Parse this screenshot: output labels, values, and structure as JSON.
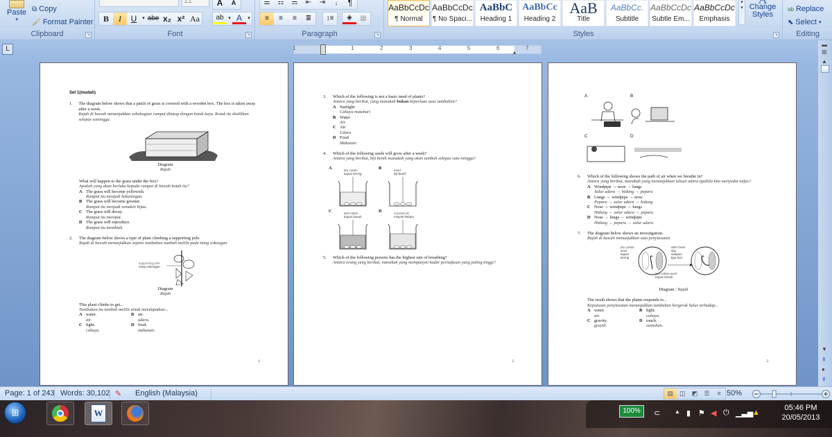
{
  "ribbon": {
    "clipboard": {
      "label": "Clipboard",
      "paste": "Paste",
      "copy": "Copy",
      "format_painter": "Format Painter"
    },
    "font": {
      "label": "Font",
      "size": "12",
      "buttons": [
        "B",
        "I",
        "U",
        "abe",
        "x₂",
        "x²",
        "Aa"
      ],
      "grow": "A",
      "shrink": "A",
      "highlight_color": "#ffff00",
      "font_color": "#e8101a"
    },
    "paragraph": {
      "label": "Paragraph"
    },
    "styles": {
      "label": "Styles",
      "items": [
        {
          "preview": "AaBbCcDc",
          "name": "¶ Normal",
          "selected": true
        },
        {
          "preview": "AaBbCcDc",
          "name": "¶ No Spaci..."
        },
        {
          "preview": "AaBbC",
          "name": "Heading 1"
        },
        {
          "preview": "AaBbCc",
          "name": "Heading 2"
        },
        {
          "preview": "AaB",
          "name": "Title"
        },
        {
          "preview": "AaBbCc.",
          "name": "Subtitle"
        },
        {
          "preview": "AaBbCcDc",
          "name": "Subtle Em..."
        },
        {
          "preview": "AaBbCcDc",
          "name": "Emphasis"
        }
      ],
      "change_styles": "Change Styles"
    },
    "editing": {
      "label": "Editing",
      "replace": "Replace",
      "select": "Select"
    }
  },
  "ruler": {
    "tab_selector": "L",
    "numbers": [
      "1",
      "1",
      "2",
      "3",
      "4",
      "5",
      "6",
      "7"
    ]
  },
  "pages": {
    "p1": {
      "set_title": "Set 1(mudah)",
      "q1": {
        "num": "1.",
        "en": "The diagram below shows that a patch of grass is covered with a wooden box. The box is taken away after a week.",
        "ms": "Rajah di bawah menunjukkan sebahagian rumput ditutup dengan kotak kayu. Kotak itu dialihkan selepas seminggu.",
        "caption_en": "Diagram",
        "caption_ms": "Rajah",
        "stem_en": "What will happen to the grass under the box?",
        "stem_ms": "Apakah yang akan berlaku kepada rumput di bawah kotak itu?",
        "options": [
          {
            "letter": "A",
            "en": "The grass will become yellowish.",
            "ms": "Rumput itu menjadi kekuningan."
          },
          {
            "letter": "B",
            "en": "The grass will become greener.",
            "ms": "Rumput itu menjadi semakin hijau."
          },
          {
            "letter": "C",
            "en": "The grass will decay.",
            "ms": "Rumput itu mereput."
          },
          {
            "letter": "D",
            "en": "The grass will reproduce.",
            "ms": "Rumput itu membiak."
          }
        ]
      },
      "q2": {
        "num": "2.",
        "en": "The diagram below shows a type of plant climbing a supporting pole.",
        "ms": "Rajah di bawah menunjukkan sejenis tumbuhan tumbuh melilit pada tiang sokongan.",
        "label_en": "supporting pole",
        "label_ms": "tiang sokongan",
        "caption_en": "Diagram",
        "caption_ms": "Rajah",
        "stem_en": "This plant climbs to get...",
        "stem_ms": "Tumbuhan itu tumbuh melilit untuk mendapatkan...",
        "options": [
          {
            "letter": "A",
            "en": "water.",
            "ms": "air."
          },
          {
            "letter": "B",
            "en": "air.",
            "ms": "udara."
          },
          {
            "letter": "C",
            "en": "light.",
            "ms": "cahaya."
          },
          {
            "letter": "D",
            "en": "food.",
            "ms": "makanan."
          }
        ]
      },
      "page_number": "1"
    },
    "p2": {
      "q3": {
        "num": "3.",
        "en": "Which of the following is not a basic need of plants?",
        "ms_pre": "Antara yang berikut, yang manakah",
        "ms_bold": "bukan",
        "ms_post": "keperluan asas tumbuhan?",
        "options": [
          {
            "letter": "A",
            "en": "Sunlight",
            "ms": "Cahaya matahari"
          },
          {
            "letter": "B",
            "en": "Water",
            "ms": "Air"
          },
          {
            "letter": "C",
            "en": "Air",
            "ms": "Udara"
          },
          {
            "letter": "D",
            "en": "Food",
            "ms": "Makanan"
          }
        ]
      },
      "q4": {
        "num": "4.",
        "en": "Which of the following seeds will grow after a week?",
        "ms": "Antara yang berikut, biji benih manakah yang akan tumbuh selepas satu minggu?",
        "beakers": [
          {
            "letter": "A",
            "en": "dry cotton",
            "ms": "kapas kering"
          },
          {
            "letter": "B",
            "en": "seed",
            "ms": "biji benih"
          },
          {
            "letter": "C",
            "en": "wet cotton",
            "ms": "kapas basah"
          },
          {
            "letter": "D",
            "en": "coconut oil",
            "ms": "minyak kelapa"
          }
        ]
      },
      "q5": {
        "num": "5.",
        "en": "Which of the following persons has the highest rate of breathing?",
        "ms": "Antara orang yang berikut, manakah yang mempunyai kadar pernafasan yang paling tinggi?"
      },
      "page_number": "2"
    },
    "p3": {
      "q5_images": [
        "A",
        "B",
        "C",
        "D"
      ],
      "q6": {
        "num": "6.",
        "en": "Which of the following shows the path of air when we breathe in?",
        "ms": "Antara yang berikut, manakah yang menunjukkan laluan udara apabila kita menyedut nafas?",
        "options": [
          {
            "letter": "A",
            "en": "Windpipe → nose → lungs",
            "ms": "Salur udara → hidung → peparu"
          },
          {
            "letter": "B",
            "en": "Lungs → windpipe → nose",
            "ms": "Peparu → salur udara → hidung"
          },
          {
            "letter": "C",
            "en": "Nose → windpipe → lungs",
            "ms": "Hidung → salur udara → peparu"
          },
          {
            "letter": "D",
            "en": "Nose → lungs → windpipe",
            "ms": "Hidung → peparu → salur udara"
          }
        ]
      },
      "q7": {
        "num": "7.",
        "en": "The diagram below shows an investigation.",
        "ms": "Rajah di bawah menunjukkan satu penyiasatan.",
        "label_dry": "dry cotton wool",
        "label_dry_ms": "kapas kering",
        "label_after": "after three day",
        "label_after_ms": "selepas tiga hari",
        "label_wet": "wet cotton wool",
        "label_wet_ms": "kapas basah",
        "caption_en": "Diagram /",
        "caption_ms": "Rajah",
        "stem_en": "The result shows that the plants responds to...",
        "stem_ms": "Keputusan penyiasatan menunjukkan tumbuhan bergerak balas terhadap...",
        "options": [
          {
            "letter": "A",
            "en": "water.",
            "ms": "air."
          },
          {
            "letter": "B",
            "en": "light.",
            "ms": "cahaya."
          },
          {
            "letter": "C",
            "en": "gravity.",
            "ms": "graviti."
          },
          {
            "letter": "D",
            "en": "touch.",
            "ms": "sentuhan."
          }
        ]
      },
      "page_number": "3"
    }
  },
  "status_bar": {
    "page": "Page: 1 of 243",
    "words": "Words: 30,102",
    "language": "English (Malaysia)",
    "zoom": "50%",
    "zoom_level_percent": 50
  },
  "taskbar": {
    "apps": [
      "start-button",
      "chrome",
      "word",
      "firefox"
    ],
    "battery": "100%",
    "time": "05:46 PM",
    "date": "20/05/2013"
  }
}
